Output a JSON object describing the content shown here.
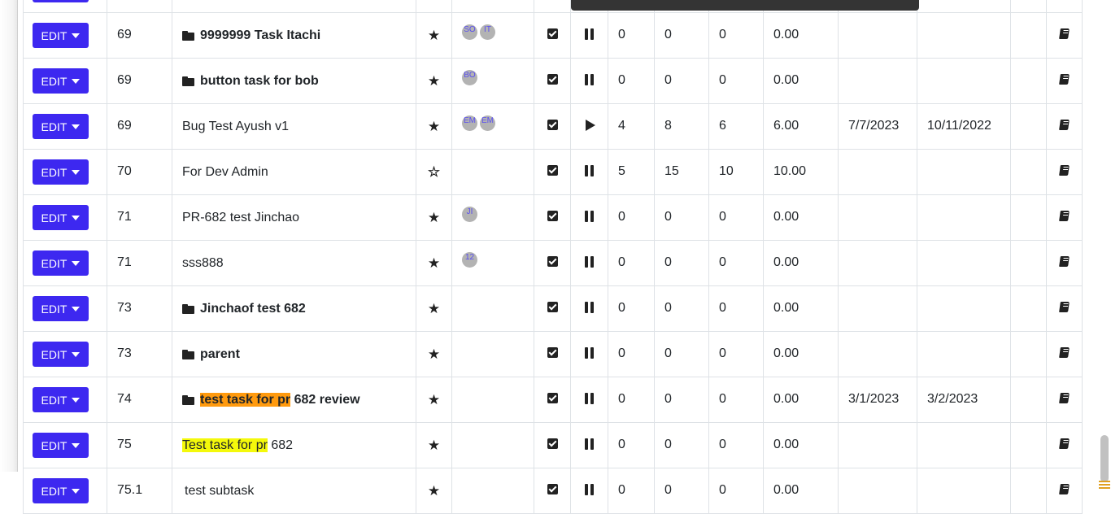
{
  "edit_label": "EDIT",
  "icons": {
    "star": "star-icon",
    "half_star": "star-half-icon",
    "check": "checkbox-icon",
    "pause": "pause-icon",
    "play": "play-icon",
    "book": "book-icon",
    "folder": "folder-icon",
    "dropdown": "caret-down-icon"
  },
  "colors": {
    "edit_button": "#3d28f0",
    "highlight_orange": "#ff9a0e",
    "highlight_yellow": "#f4f90b",
    "avatar_bg": "#b3b3b3",
    "avatar_text": "#5a4ff0"
  },
  "rows": [
    {
      "num": "69",
      "folder": true,
      "bold": true,
      "title": "9999999 Task Itachi",
      "star": "full",
      "avatars": [
        "SO",
        "IT"
      ],
      "state": "pause",
      "c1": "0",
      "c2": "0",
      "c3": "0",
      "c4": "0.00",
      "start": "",
      "end": ""
    },
    {
      "num": "69",
      "folder": true,
      "bold": true,
      "title": "button task for bob",
      "star": "full",
      "avatars": [
        "BO"
      ],
      "state": "pause",
      "c1": "0",
      "c2": "0",
      "c3": "0",
      "c4": "0.00",
      "start": "",
      "end": ""
    },
    {
      "num": "69",
      "folder": false,
      "bold": false,
      "title": "Bug Test Ayush v1",
      "star": "full",
      "avatars": [
        "EM",
        "EM"
      ],
      "state": "play",
      "c1": "4",
      "c2": "8",
      "c3": "6",
      "c4": "6.00",
      "start": "7/7/2023",
      "end": "10/11/2022"
    },
    {
      "num": "70",
      "folder": false,
      "bold": false,
      "title": "For Dev Admin",
      "star": "half",
      "avatars": [],
      "state": "pause",
      "c1": "5",
      "c2": "15",
      "c3": "10",
      "c4": "10.00",
      "start": "",
      "end": ""
    },
    {
      "num": "71",
      "folder": false,
      "bold": false,
      "title": "PR-682 test Jinchao",
      "star": "full",
      "avatars": [
        "JI"
      ],
      "state": "pause",
      "c1": "0",
      "c2": "0",
      "c3": "0",
      "c4": "0.00",
      "start": "",
      "end": ""
    },
    {
      "num": "71",
      "folder": false,
      "bold": false,
      "title": "sss888",
      "star": "full",
      "avatars": [
        "12"
      ],
      "state": "pause",
      "c1": "0",
      "c2": "0",
      "c3": "0",
      "c4": "0.00",
      "start": "",
      "end": ""
    },
    {
      "num": "73",
      "folder": true,
      "bold": true,
      "title": "Jinchaof test 682",
      "star": "full",
      "avatars": [],
      "state": "pause",
      "c1": "0",
      "c2": "0",
      "c3": "0",
      "c4": "0.00",
      "start": "",
      "end": ""
    },
    {
      "num": "73",
      "folder": true,
      "bold": true,
      "title": "parent",
      "star": "full",
      "avatars": [],
      "state": "pause",
      "c1": "0",
      "c2": "0",
      "c3": "0",
      "c4": "0.00",
      "start": "",
      "end": ""
    },
    {
      "num": "74",
      "folder": true,
      "bold": true,
      "title_highlight": "test task for pr",
      "title_rest": " 682 review",
      "highlight": "orange",
      "star": "full",
      "avatars": [],
      "state": "pause",
      "c1": "0",
      "c2": "0",
      "c3": "0",
      "c4": "0.00",
      "start": "3/1/2023",
      "end": "3/2/2023"
    },
    {
      "num": "75",
      "folder": false,
      "bold": false,
      "title_highlight": "Test task for pr",
      "title_rest": " 682",
      "highlight": "yellow",
      "star": "full",
      "avatars": [],
      "state": "pause",
      "c1": "0",
      "c2": "0",
      "c3": "0",
      "c4": "0.00",
      "start": "",
      "end": ""
    },
    {
      "num": "75.1",
      "folder": false,
      "bold": false,
      "indent": true,
      "title": "test subtask",
      "star": "full",
      "avatars": [],
      "state": "pause",
      "c1": "0",
      "c2": "0",
      "c3": "0",
      "c4": "0.00",
      "start": "",
      "end": ""
    }
  ]
}
